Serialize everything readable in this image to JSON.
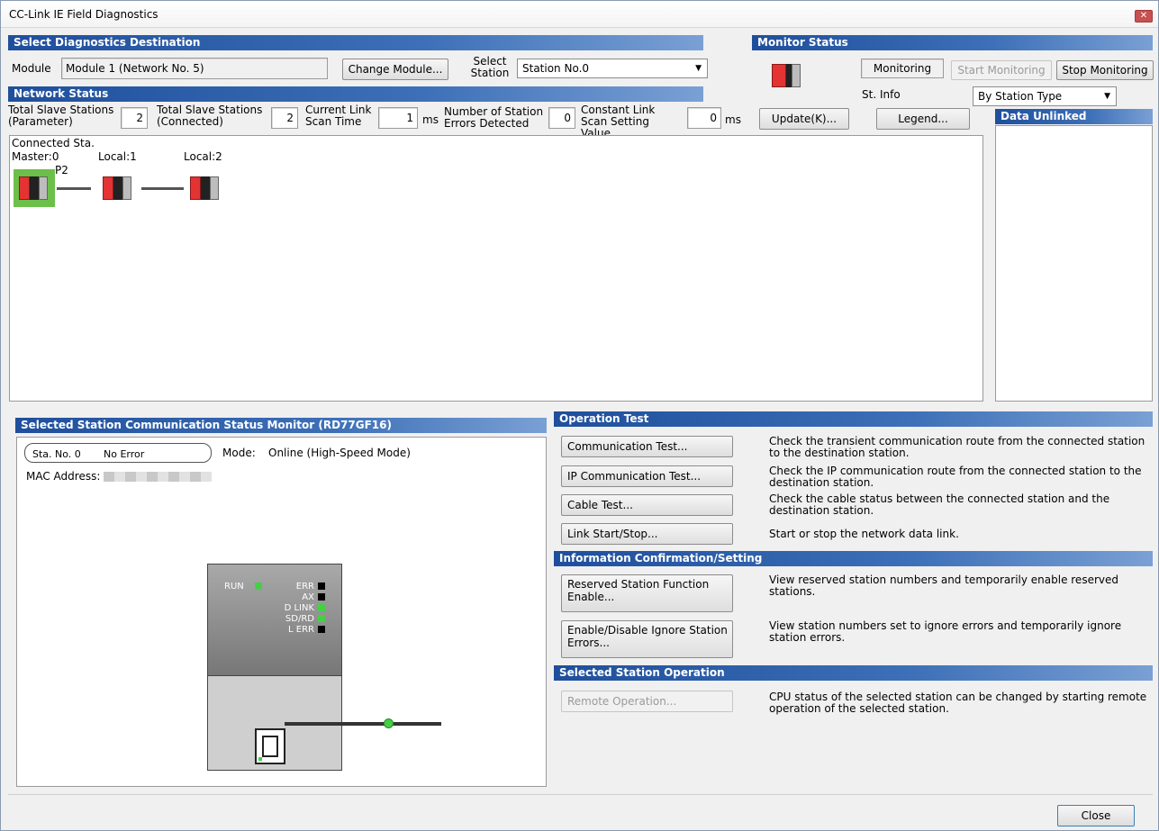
{
  "window": {
    "title": "CC-Link IE Field Diagnostics",
    "close_glyph": "✕"
  },
  "destination": {
    "header": "Select Diagnostics Destination",
    "module_label": "Module",
    "module_value": "Module 1 (Network No. 5)",
    "change_module_label": "Change Module...",
    "select_station_label": "Select Station",
    "station_value": "Station No.0"
  },
  "monitor": {
    "header": "Monitor Status",
    "status_text": "Monitoring",
    "start_label": "Start Monitoring",
    "stop_label": "Stop Monitoring",
    "st_info_label": "St. Info",
    "st_info_value": "By Station Type"
  },
  "network": {
    "header": "Network Status",
    "total_param_label": "Total Slave Stations (Parameter)",
    "total_param_value": "2",
    "total_conn_label": "Total Slave Stations (Connected)",
    "total_conn_value": "2",
    "scan_time_label": "Current Link Scan Time",
    "scan_time_value": "1",
    "scan_time_unit": "ms",
    "errors_label": "Number of Station Errors Detected",
    "errors_value": "0",
    "const_scan_label": "Constant Link Scan Setting Value",
    "const_scan_value": "0",
    "const_scan_unit": "ms",
    "update_label": "Update(K)...",
    "legend_label": "Legend...",
    "data_unlinked_header": "Data Unlinked",
    "connected_label": "Connected Sta.",
    "port_label": "P2",
    "stations": [
      {
        "label": "Master:0"
      },
      {
        "label": "Local:1"
      },
      {
        "label": "Local:2"
      }
    ]
  },
  "selected_station": {
    "header": "Selected Station Communication Status Monitor (RD77GF16)",
    "sta_no": "Sta. No. 0",
    "status": "No Error",
    "mode_label": "Mode:",
    "mode_value": "Online (High-Speed Mode)",
    "mac_label": "MAC Address:",
    "leds": {
      "run": "RUN",
      "err": "ERR",
      "ax": "AX",
      "dlink": "D LINK",
      "sdrd": "SD/RD",
      "lerr": "L ERR"
    }
  },
  "operation_test": {
    "header": "Operation Test",
    "items": [
      {
        "button": "Communication Test...",
        "desc": "Check the transient communication route from the connected station to the destination station."
      },
      {
        "button": "IP Communication Test...",
        "desc": "Check the IP communication route from the connected station to the destination station."
      },
      {
        "button": "Cable Test...",
        "desc": "Check the cable status between the connected station and the destination station."
      },
      {
        "button": "Link Start/Stop...",
        "desc": "Start or stop the network data link."
      }
    ]
  },
  "info_confirm": {
    "header": "Information Confirmation/Setting",
    "items": [
      {
        "button": "Reserved Station Function Enable...",
        "desc": "View reserved station numbers and temporarily enable reserved stations."
      },
      {
        "button": "Enable/Disable Ignore Station Errors...",
        "desc": "View station numbers set to ignore errors and temporarily ignore station errors."
      }
    ]
  },
  "selected_op": {
    "header": "Selected Station Operation",
    "items": [
      {
        "button": "Remote Operation...",
        "desc": "CPU status of the selected station can be changed by starting remote operation of the selected station."
      }
    ]
  },
  "footer": {
    "close_label": "Close"
  },
  "colors": {
    "header_blue": "#1f4f9c",
    "led_green": "#44d044",
    "selected_green": "#6cc04a",
    "station_red": "#e33333"
  }
}
